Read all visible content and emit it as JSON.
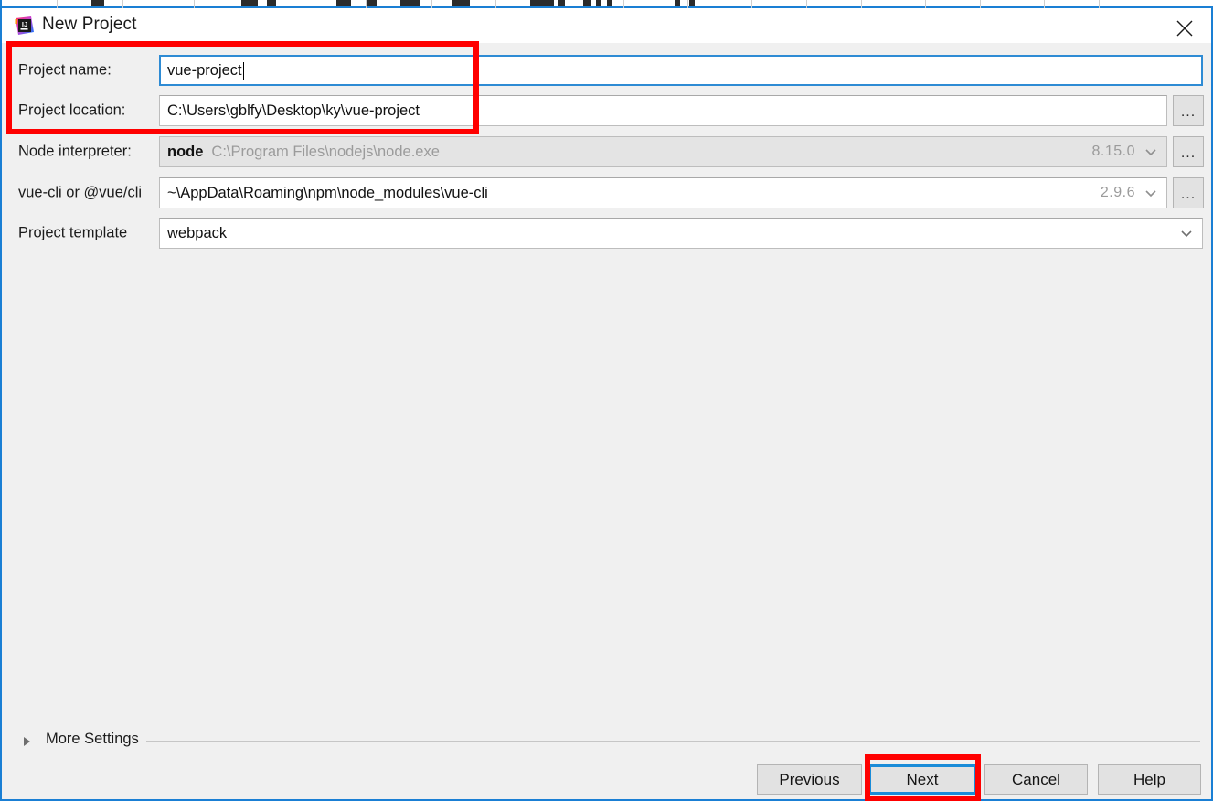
{
  "window": {
    "title": "New Project",
    "app_icon": "intellij-idea-icon",
    "close_icon": "close-icon",
    "accent_color": "#1a7fd4",
    "background_color": "#f0f0f0",
    "annotation_color": "#ff0000",
    "focus_color": "#1a8cd8"
  },
  "form": {
    "rows": [
      {
        "id": "project-name",
        "label": "Project name:",
        "value": "vue-project",
        "focused": true,
        "has_caret": true,
        "has_browse": false,
        "has_dropdown": false,
        "disabled": false
      },
      {
        "id": "project-location",
        "label": "Project location:",
        "value": "C:\\Users\\gblfy\\Desktop\\ky\\vue-project",
        "focused": false,
        "has_caret": false,
        "has_browse": true,
        "browse_label": "...",
        "has_dropdown": false,
        "disabled": false
      },
      {
        "id": "node-interpreter",
        "label": "Node interpreter:",
        "value_bold": "node",
        "value_path": "C:\\Program Files\\nodejs\\node.exe",
        "version": "8.15.0",
        "focused": false,
        "has_caret": false,
        "has_browse": true,
        "browse_label": "...",
        "has_dropdown": true,
        "disabled": true
      },
      {
        "id": "vue-cli",
        "label": "vue-cli or @vue/cli",
        "value": "~\\AppData\\Roaming\\npm\\node_modules\\vue-cli",
        "version": "2.9.6",
        "focused": false,
        "has_caret": false,
        "has_browse": true,
        "browse_label": "...",
        "has_dropdown": true,
        "disabled": false
      },
      {
        "id": "project-template",
        "label": "Project template",
        "value": "webpack",
        "focused": false,
        "has_caret": false,
        "has_browse": false,
        "has_dropdown": true,
        "disabled": false
      }
    ]
  },
  "more_settings": {
    "label": "More Settings",
    "expanded": false,
    "triangle_icon": "triangle-right-icon"
  },
  "footer": {
    "buttons": [
      {
        "id": "previous",
        "label": "Previous",
        "focused": false
      },
      {
        "id": "next",
        "label": "Next",
        "focused": true
      },
      {
        "id": "cancel",
        "label": "Cancel",
        "focused": false
      },
      {
        "id": "help",
        "label": "Help",
        "focused": false
      }
    ]
  },
  "annotations": [
    {
      "id": "fields-highlight",
      "target": "project-name and project-location rows"
    },
    {
      "id": "next-highlight",
      "target": "next button"
    }
  ]
}
